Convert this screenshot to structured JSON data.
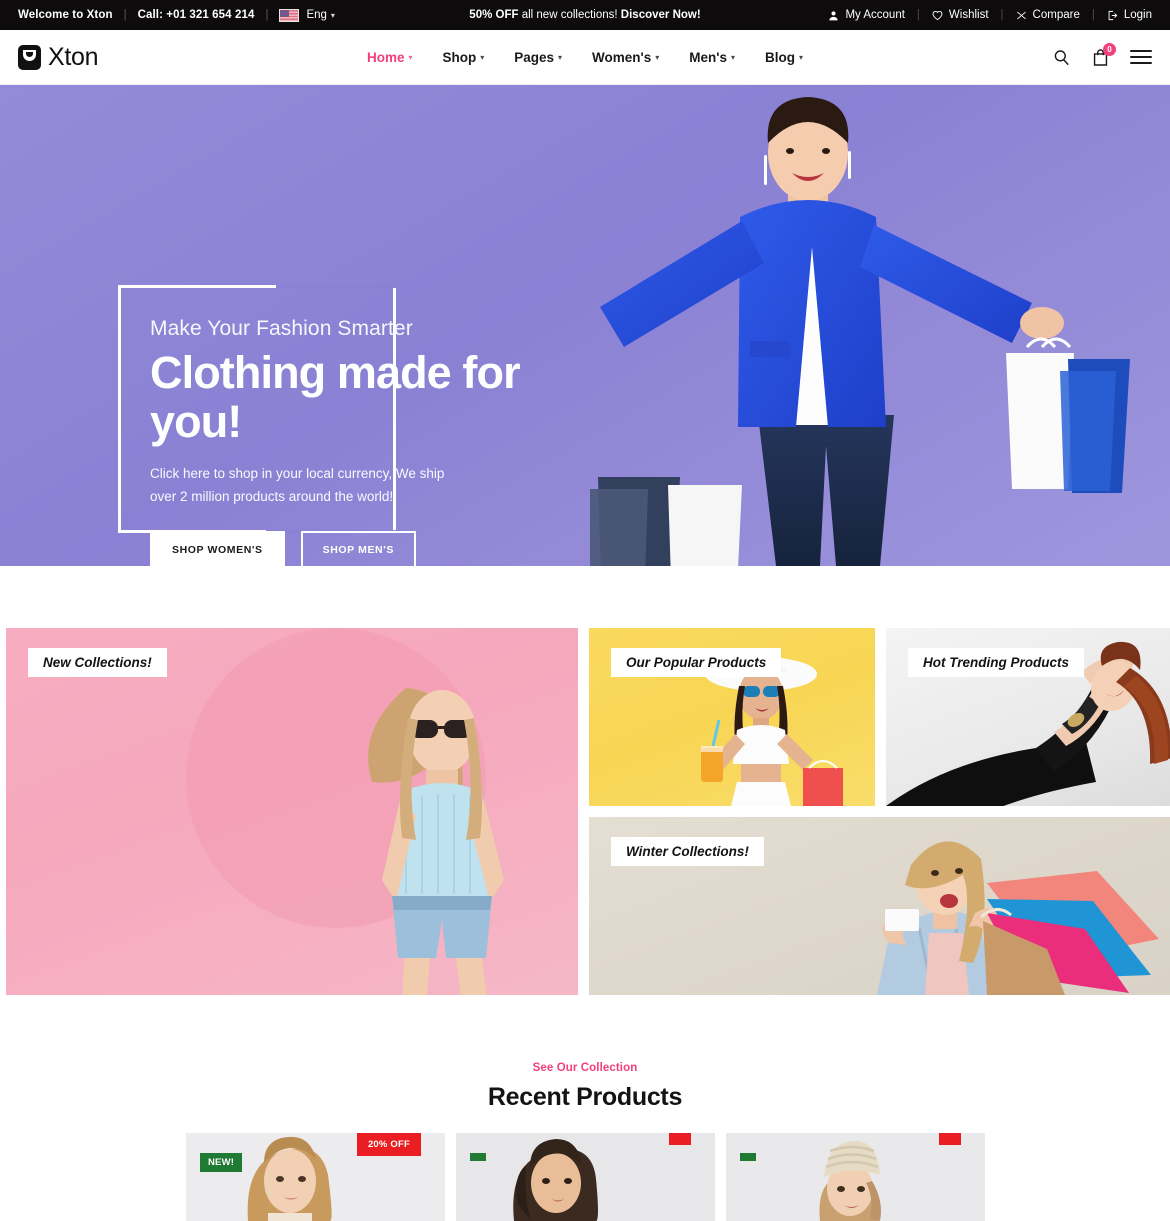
{
  "topbar": {
    "welcome": "Welcome to Xton",
    "phone": "Call: +01 321 654 214",
    "separator": "|",
    "language": "Eng",
    "flag_icon": "us-flag-icon",
    "promo_strong": "50% OFF",
    "promo_text": " all new collections! ",
    "promo_link": "Discover Now!",
    "account": "My Account",
    "wishlist": "Wishlist",
    "compare": "Compare",
    "login": "Login"
  },
  "nav": {
    "brand": "Xton",
    "logo_icon": "shopping-bag-smile-icon",
    "menu": [
      {
        "label": "Home",
        "caret": "⌄",
        "active": true
      },
      {
        "label": "Shop",
        "caret": "⌄",
        "active": false
      },
      {
        "label": "Pages",
        "caret": "⌄",
        "active": false
      },
      {
        "label": "Women's",
        "caret": "⌄",
        "active": false
      },
      {
        "label": "Men's",
        "caret": "⌄",
        "active": false
      },
      {
        "label": "Blog",
        "caret": "⌄",
        "active": false
      }
    ],
    "search_icon": "search-icon",
    "cart_icon": "cart-icon",
    "cart_count": "0",
    "menu_icon": "hamburger-menu-icon",
    "accent_color": "#f2417a"
  },
  "hero": {
    "kicker": "Make Your Fashion Smarter",
    "title": "Clothing made for you!",
    "subtitle": "Click here to shop in your local currency, We ship over 2 million products around the world!",
    "btn_women": "SHOP WOMEN'S",
    "btn_men": "SHOP MEN'S",
    "background_color": "#8b81d4"
  },
  "banners": [
    {
      "label": "New Collections!",
      "bg": "#f6a8bd"
    },
    {
      "label": "Our Popular Products",
      "bg": "#f8d654"
    },
    {
      "label": "Hot Trending Products",
      "bg": "#e9e9e9"
    },
    {
      "label": "Winter Collections!",
      "bg": "#ded7cb"
    }
  ],
  "recent": {
    "kicker": "See Our Collection",
    "title": "Recent Products",
    "products": [
      {
        "badge_new": "NEW!",
        "badge_off": "20% OFF"
      },
      {
        "badge_new": "",
        "badge_off": ""
      },
      {
        "badge_new": "",
        "badge_off": ""
      }
    ]
  }
}
